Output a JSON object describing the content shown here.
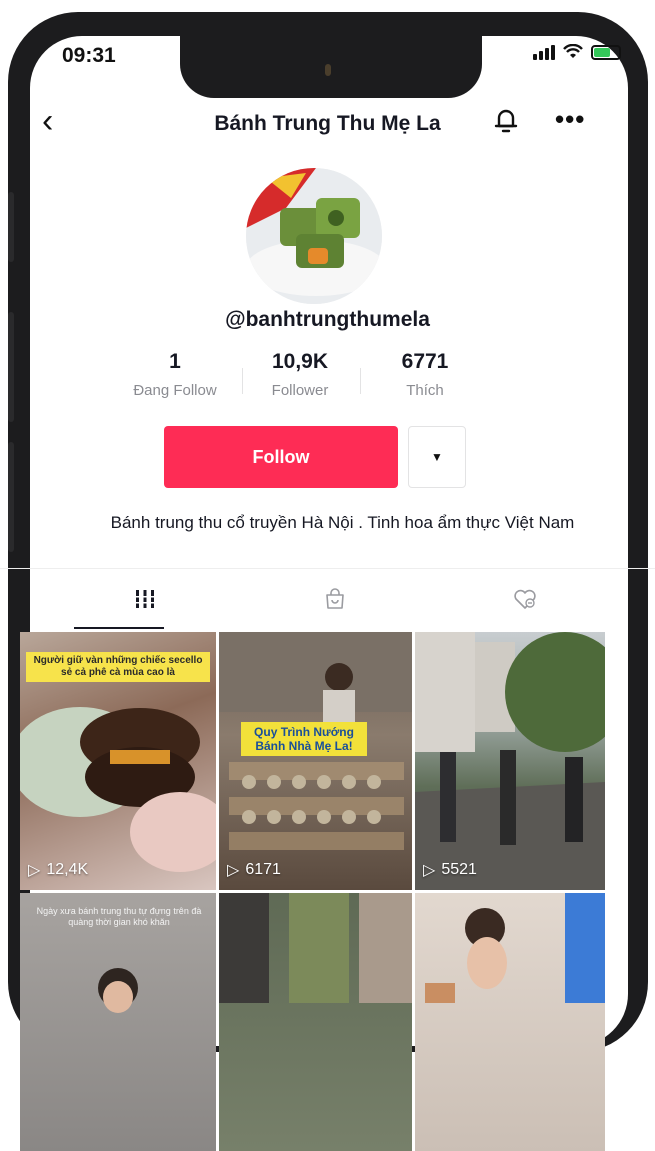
{
  "status_bar": {
    "time": "09:31"
  },
  "header": {
    "title": "Bánh Trung Thu Mẹ La"
  },
  "profile": {
    "handle": "@banhtrungthumela",
    "stats": [
      {
        "value": "1",
        "label": "Đang Follow"
      },
      {
        "value": "10,9K",
        "label": "Follower"
      },
      {
        "value": "6771",
        "label": "Thích"
      }
    ],
    "follow_label": "Follow",
    "bio": "Bánh trung thu cổ truyền Hà Nội . Tinh hoa ẩm thực Việt Nam"
  },
  "videos": [
    {
      "views": "12,4K",
      "caption": "Người giữ vàn những chiếc secello sẻ cả phê cà mùa cao là"
    },
    {
      "views": "6171",
      "caption": "Quy Trình Nướng Bánh Nhà Mẹ La!"
    },
    {
      "views": "5521",
      "caption": ""
    },
    {
      "views": "",
      "caption": "Ngày xưa bánh trung thu tự đựng trên đà quàng thời gian khó khăn"
    },
    {
      "views": "",
      "caption": ""
    },
    {
      "views": "",
      "caption": ""
    }
  ],
  "colors": {
    "accent": "#fe2c55",
    "text": "#161823",
    "muted": "#8a8b91"
  }
}
